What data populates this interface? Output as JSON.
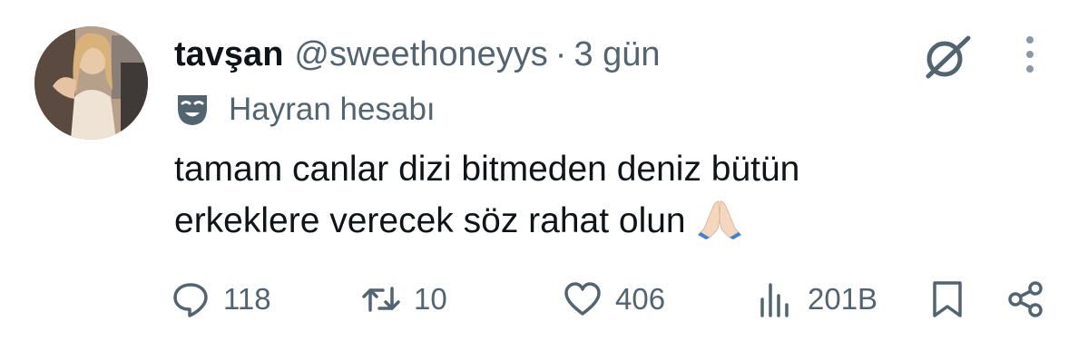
{
  "author": {
    "display_name": "tavşan",
    "handle": "@sweethoneyys",
    "separator": "·",
    "time": "3 gün"
  },
  "badge": {
    "icon": "theater-mask-icon",
    "label": "Hayran hesabı"
  },
  "tweet": {
    "line1": "tamam canlar dizi bitmeden deniz bütün",
    "line2": "erkeklere verecek söz rahat olun",
    "emoji": "folded-hands-emoji"
  },
  "actions": {
    "replies": "118",
    "retweets": "10",
    "likes": "406",
    "views": "201B"
  },
  "colors": {
    "text": "#0f1419",
    "secondary": "#536471"
  }
}
